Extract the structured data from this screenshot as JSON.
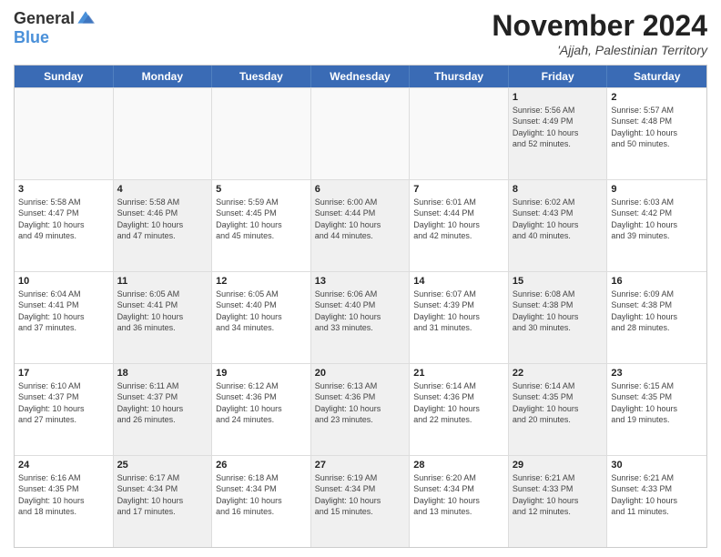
{
  "header": {
    "logo_general": "General",
    "logo_blue": "Blue",
    "month_title": "November 2024",
    "location": "'Ajjah, Palestinian Territory"
  },
  "calendar": {
    "days_of_week": [
      "Sunday",
      "Monday",
      "Tuesday",
      "Wednesday",
      "Thursday",
      "Friday",
      "Saturday"
    ],
    "rows": [
      [
        {
          "day": "",
          "empty": true,
          "info": ""
        },
        {
          "day": "",
          "empty": true,
          "info": ""
        },
        {
          "day": "",
          "empty": true,
          "info": ""
        },
        {
          "day": "",
          "empty": true,
          "info": ""
        },
        {
          "day": "",
          "empty": true,
          "info": ""
        },
        {
          "day": "1",
          "empty": false,
          "shaded": true,
          "info": "Sunrise: 5:56 AM\nSunset: 4:49 PM\nDaylight: 10 hours\nand 52 minutes."
        },
        {
          "day": "2",
          "empty": false,
          "shaded": false,
          "info": "Sunrise: 5:57 AM\nSunset: 4:48 PM\nDaylight: 10 hours\nand 50 minutes."
        }
      ],
      [
        {
          "day": "3",
          "empty": false,
          "shaded": false,
          "info": "Sunrise: 5:58 AM\nSunset: 4:47 PM\nDaylight: 10 hours\nand 49 minutes."
        },
        {
          "day": "4",
          "empty": false,
          "shaded": true,
          "info": "Sunrise: 5:58 AM\nSunset: 4:46 PM\nDaylight: 10 hours\nand 47 minutes."
        },
        {
          "day": "5",
          "empty": false,
          "shaded": false,
          "info": "Sunrise: 5:59 AM\nSunset: 4:45 PM\nDaylight: 10 hours\nand 45 minutes."
        },
        {
          "day": "6",
          "empty": false,
          "shaded": true,
          "info": "Sunrise: 6:00 AM\nSunset: 4:44 PM\nDaylight: 10 hours\nand 44 minutes."
        },
        {
          "day": "7",
          "empty": false,
          "shaded": false,
          "info": "Sunrise: 6:01 AM\nSunset: 4:44 PM\nDaylight: 10 hours\nand 42 minutes."
        },
        {
          "day": "8",
          "empty": false,
          "shaded": true,
          "info": "Sunrise: 6:02 AM\nSunset: 4:43 PM\nDaylight: 10 hours\nand 40 minutes."
        },
        {
          "day": "9",
          "empty": false,
          "shaded": false,
          "info": "Sunrise: 6:03 AM\nSunset: 4:42 PM\nDaylight: 10 hours\nand 39 minutes."
        }
      ],
      [
        {
          "day": "10",
          "empty": false,
          "shaded": false,
          "info": "Sunrise: 6:04 AM\nSunset: 4:41 PM\nDaylight: 10 hours\nand 37 minutes."
        },
        {
          "day": "11",
          "empty": false,
          "shaded": true,
          "info": "Sunrise: 6:05 AM\nSunset: 4:41 PM\nDaylight: 10 hours\nand 36 minutes."
        },
        {
          "day": "12",
          "empty": false,
          "shaded": false,
          "info": "Sunrise: 6:05 AM\nSunset: 4:40 PM\nDaylight: 10 hours\nand 34 minutes."
        },
        {
          "day": "13",
          "empty": false,
          "shaded": true,
          "info": "Sunrise: 6:06 AM\nSunset: 4:40 PM\nDaylight: 10 hours\nand 33 minutes."
        },
        {
          "day": "14",
          "empty": false,
          "shaded": false,
          "info": "Sunrise: 6:07 AM\nSunset: 4:39 PM\nDaylight: 10 hours\nand 31 minutes."
        },
        {
          "day": "15",
          "empty": false,
          "shaded": true,
          "info": "Sunrise: 6:08 AM\nSunset: 4:38 PM\nDaylight: 10 hours\nand 30 minutes."
        },
        {
          "day": "16",
          "empty": false,
          "shaded": false,
          "info": "Sunrise: 6:09 AM\nSunset: 4:38 PM\nDaylight: 10 hours\nand 28 minutes."
        }
      ],
      [
        {
          "day": "17",
          "empty": false,
          "shaded": false,
          "info": "Sunrise: 6:10 AM\nSunset: 4:37 PM\nDaylight: 10 hours\nand 27 minutes."
        },
        {
          "day": "18",
          "empty": false,
          "shaded": true,
          "info": "Sunrise: 6:11 AM\nSunset: 4:37 PM\nDaylight: 10 hours\nand 26 minutes."
        },
        {
          "day": "19",
          "empty": false,
          "shaded": false,
          "info": "Sunrise: 6:12 AM\nSunset: 4:36 PM\nDaylight: 10 hours\nand 24 minutes."
        },
        {
          "day": "20",
          "empty": false,
          "shaded": true,
          "info": "Sunrise: 6:13 AM\nSunset: 4:36 PM\nDaylight: 10 hours\nand 23 minutes."
        },
        {
          "day": "21",
          "empty": false,
          "shaded": false,
          "info": "Sunrise: 6:14 AM\nSunset: 4:36 PM\nDaylight: 10 hours\nand 22 minutes."
        },
        {
          "day": "22",
          "empty": false,
          "shaded": true,
          "info": "Sunrise: 6:14 AM\nSunset: 4:35 PM\nDaylight: 10 hours\nand 20 minutes."
        },
        {
          "day": "23",
          "empty": false,
          "shaded": false,
          "info": "Sunrise: 6:15 AM\nSunset: 4:35 PM\nDaylight: 10 hours\nand 19 minutes."
        }
      ],
      [
        {
          "day": "24",
          "empty": false,
          "shaded": false,
          "info": "Sunrise: 6:16 AM\nSunset: 4:35 PM\nDaylight: 10 hours\nand 18 minutes."
        },
        {
          "day": "25",
          "empty": false,
          "shaded": true,
          "info": "Sunrise: 6:17 AM\nSunset: 4:34 PM\nDaylight: 10 hours\nand 17 minutes."
        },
        {
          "day": "26",
          "empty": false,
          "shaded": false,
          "info": "Sunrise: 6:18 AM\nSunset: 4:34 PM\nDaylight: 10 hours\nand 16 minutes."
        },
        {
          "day": "27",
          "empty": false,
          "shaded": true,
          "info": "Sunrise: 6:19 AM\nSunset: 4:34 PM\nDaylight: 10 hours\nand 15 minutes."
        },
        {
          "day": "28",
          "empty": false,
          "shaded": false,
          "info": "Sunrise: 6:20 AM\nSunset: 4:34 PM\nDaylight: 10 hours\nand 13 minutes."
        },
        {
          "day": "29",
          "empty": false,
          "shaded": true,
          "info": "Sunrise: 6:21 AM\nSunset: 4:33 PM\nDaylight: 10 hours\nand 12 minutes."
        },
        {
          "day": "30",
          "empty": false,
          "shaded": false,
          "info": "Sunrise: 6:21 AM\nSunset: 4:33 PM\nDaylight: 10 hours\nand 11 minutes."
        }
      ]
    ]
  }
}
